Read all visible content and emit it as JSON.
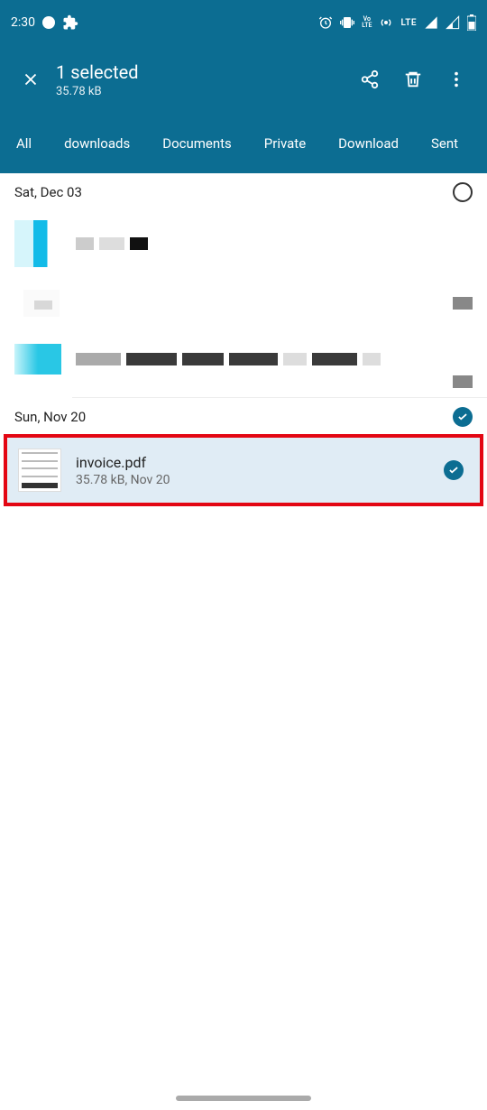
{
  "status_bar": {
    "time": "2:30",
    "lte": "LTE",
    "volte": "Vo\nLTE"
  },
  "app_bar": {
    "title": "1 selected",
    "subtitle": "35.78 kB"
  },
  "tabs": {
    "items": [
      "All",
      "downloads",
      "Documents",
      "Private",
      "Download",
      "Sent"
    ],
    "active_index": 2
  },
  "sections": [
    {
      "date": "Sat, Dec 03",
      "selected": false
    },
    {
      "date": "Sun, Nov 20",
      "selected": true
    }
  ],
  "selected_file": {
    "name": "invoice.pdf",
    "meta": "35.78 kB, Nov 20"
  }
}
